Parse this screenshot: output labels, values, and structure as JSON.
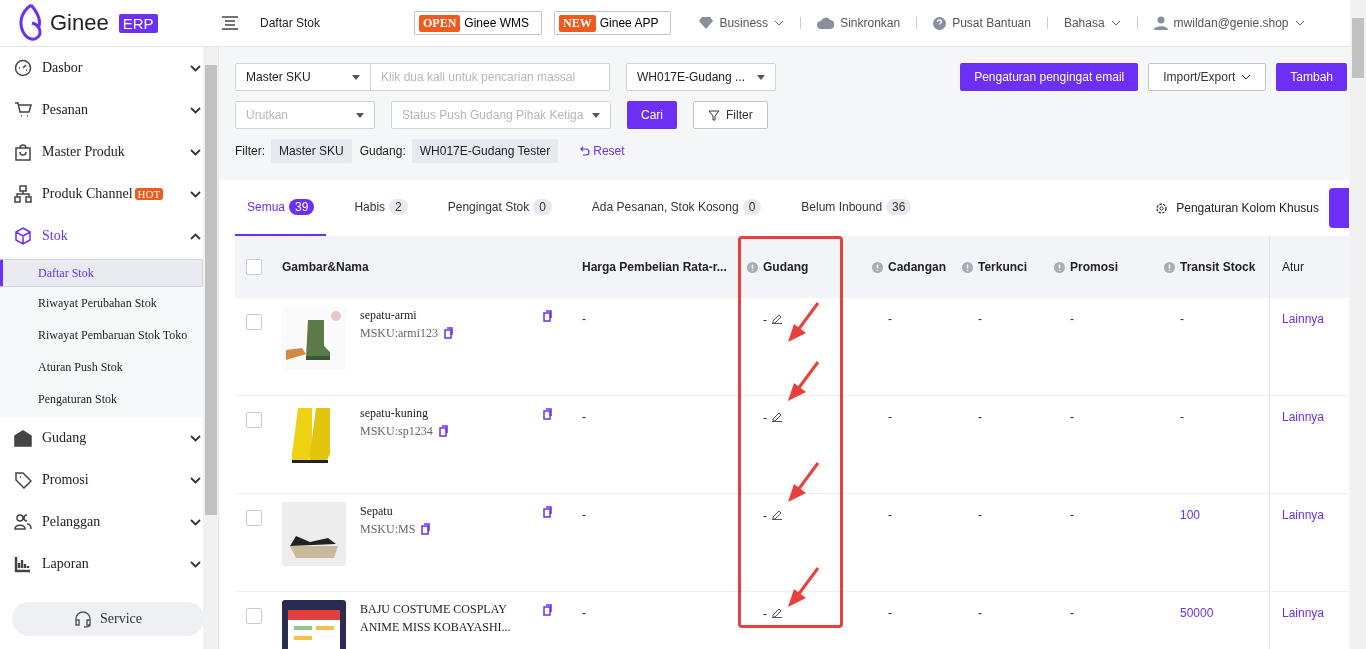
{
  "header": {
    "logo": "Ginee",
    "logo_badge": "ERP",
    "page_title": "Daftar Stok",
    "promos": [
      {
        "badge": "OPEN",
        "label": "Ginee WMS"
      },
      {
        "badge": "NEW",
        "label": "Ginee APP"
      }
    ],
    "nav": [
      {
        "kind": "business",
        "label": "Business"
      },
      {
        "kind": "sync",
        "label": "Sinkronkan"
      },
      {
        "kind": "help",
        "label": "Pusat Bantuan"
      },
      {
        "kind": "language",
        "label": "Bahasa"
      },
      {
        "kind": "user",
        "label": "mwildan@genie.shop"
      }
    ]
  },
  "sidebar": {
    "items": [
      {
        "kind": "dashboard",
        "label": "Dasbor",
        "expanded": false
      },
      {
        "kind": "cart",
        "label": "Pesanan",
        "expanded": false
      },
      {
        "kind": "bag",
        "label": "Master Produk",
        "expanded": false
      },
      {
        "kind": "network",
        "label": "Produk Channel",
        "badge": "HOT",
        "expanded": false
      },
      {
        "kind": "box",
        "label": "Stok",
        "expanded": true,
        "children": [
          {
            "label": "Daftar Stok",
            "selected": true
          },
          {
            "label": "Riwayat Perubahan Stok",
            "selected": false
          },
          {
            "label": "Riwayat Pembaruan Stok Toko",
            "selected": false
          },
          {
            "label": "Aturan Push Stok",
            "selected": false
          },
          {
            "label": "Pengaturan Stok",
            "selected": false
          }
        ]
      },
      {
        "kind": "warehouse",
        "label": "Gudang",
        "expanded": false
      },
      {
        "kind": "tag",
        "label": "Promosi",
        "expanded": false
      },
      {
        "kind": "people",
        "label": "Pelanggan",
        "expanded": false
      },
      {
        "kind": "chart",
        "label": "Laporan",
        "expanded": false
      }
    ],
    "service_button": "Service"
  },
  "filters": {
    "search_type": "Master SKU",
    "search_placeholder": "Klik dua kali untuk pencarian massal",
    "warehouse": "WH017E-Gudang ...",
    "sort_placeholder": "Urutkan",
    "push_status_placeholder": "Status Push Gudang Pihak Ketiga",
    "search_button": "Cari",
    "filter_button": "Filter",
    "email_button": "Pengaturan pengingat email",
    "import_export": "Import/Export",
    "add_button": "Tambah",
    "active_label": "Filter:",
    "chips": [
      {
        "label": "Master SKU"
      },
      {
        "label": "Gudang:",
        "value": "WH017E-Gudang Tester"
      }
    ],
    "reset": "Reset"
  },
  "tabs": [
    {
      "label": "Semua",
      "count": "39",
      "selected": true
    },
    {
      "label": "Habis",
      "count": "2",
      "selected": false
    },
    {
      "label": "Pengingat Stok",
      "count": "0",
      "selected": false
    },
    {
      "label": "Ada Pesanan, Stok Kosong",
      "count": "0",
      "selected": false
    },
    {
      "label": "Belum Inbound",
      "count": "36",
      "selected": false
    }
  ],
  "column_settings": "Pengaturan Kolom Khusus",
  "table": {
    "all_checked": false,
    "columns": [
      {
        "label": "Gambar&Nama",
        "info": false,
        "highlighted": false
      },
      {
        "label": "Harga Pembelian Rata-r...",
        "info": false,
        "highlighted": false
      },
      {
        "label": "Gudang",
        "info": true,
        "highlighted": true
      },
      {
        "label": "Cadangan",
        "info": true,
        "highlighted": false
      },
      {
        "label": "Terkunci",
        "info": true,
        "highlighted": false
      },
      {
        "label": "Promosi",
        "info": true,
        "highlighted": false
      },
      {
        "label": "Transit Stock",
        "info": true,
        "highlighted": false
      },
      {
        "label": "Atur",
        "info": false,
        "highlighted": false
      }
    ],
    "rows": [
      {
        "name": "sepatu-armi",
        "msku": "MSKU:armi123",
        "harga": "-",
        "gudang": "-",
        "cadangan": "-",
        "terkunci": "-",
        "promosi": "-",
        "transit": "-",
        "transit_link": false,
        "action": "Lainnya",
        "checked": false,
        "arrow": true
      },
      {
        "name": "sepatu-kuning",
        "msku": "MSKU:sp1234",
        "harga": "-",
        "gudang": "-",
        "cadangan": "-",
        "terkunci": "-",
        "promosi": "-",
        "transit": "-",
        "transit_link": false,
        "action": "Lainnya",
        "checked": false,
        "arrow": true
      },
      {
        "name": "Sepatu",
        "msku": "MSKU:MS",
        "harga": "-",
        "gudang": "-",
        "cadangan": "-",
        "terkunci": "-",
        "promosi": "-",
        "transit": "100",
        "transit_link": true,
        "action": "Lainnya",
        "checked": false,
        "arrow": true
      },
      {
        "name": "BAJU COSTUME COSPLAY ANIME MISS KOBAYASHI...",
        "harga": "-",
        "gudang": "-",
        "cadangan": "-",
        "terkunci": "-",
        "promosi": "-",
        "transit": "50000",
        "transit_link": true,
        "action": "Lainnya",
        "checked": false,
        "arrow": true
      }
    ]
  }
}
